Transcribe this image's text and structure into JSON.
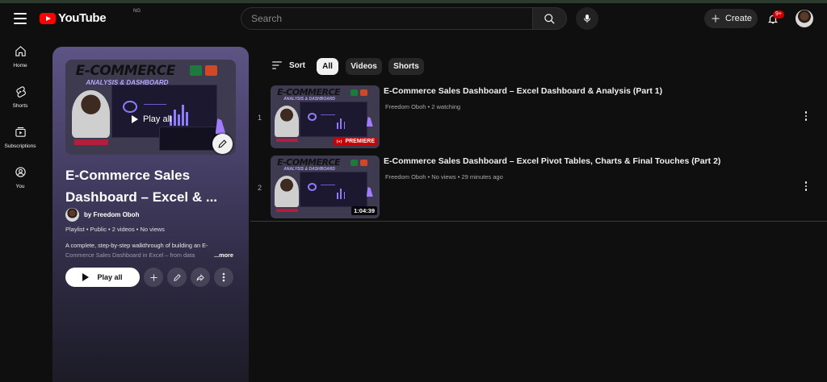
{
  "masthead": {
    "logo_text": "YouTube",
    "logo_country": "NG",
    "search_placeholder": "Search",
    "create_label": "Create",
    "notification_count": "9+"
  },
  "guide": {
    "items": [
      {
        "label": "Home",
        "icon": "home-icon"
      },
      {
        "label": "Shorts",
        "icon": "shorts-icon"
      },
      {
        "label": "Subscriptions",
        "icon": "subscriptions-icon"
      },
      {
        "label": "You",
        "icon": "you-icon"
      }
    ]
  },
  "playlist": {
    "thumb_overlay": "Play all",
    "title": "E-Commerce Sales Dashboard – Excel & ...",
    "owner": "by Freedom Oboh",
    "meta": "Playlist • Public • 2 videos • No views",
    "description_line1": "A complete, step-by-step walkthrough of building an E-",
    "description_line2": "Commerce Sales Dashboard in Excel – from data",
    "more": "...more",
    "play_all": "Play all"
  },
  "thumb_art": {
    "title": "E-COMMERCE",
    "subtitle": "ANALYSIS & DASHBOARD"
  },
  "filters": {
    "sort_label": "Sort",
    "chips": [
      "All",
      "Videos",
      "Shorts"
    ]
  },
  "videos": [
    {
      "index": "1",
      "title": "E-Commerce Sales Dashboard – Excel Dashboard & Analysis (Part 1)",
      "meta": "Freedom Oboh • 2 watching",
      "badge": "PREMIERE"
    },
    {
      "index": "2",
      "title": "E-Commerce Sales Dashboard – Excel Pivot Tables, Charts & Final Touches (Part 2)",
      "meta": "Freedom Oboh • No views • 29 minutes ago",
      "duration": "1:04:39"
    }
  ],
  "colors": {
    "background": "#0f0f0f",
    "brand_red": "#ff0000",
    "premiere_red": "#cc0000",
    "panel_top": "#5d5484",
    "chip_active": "#f1f1f1",
    "chip_inactive": "#272727"
  }
}
